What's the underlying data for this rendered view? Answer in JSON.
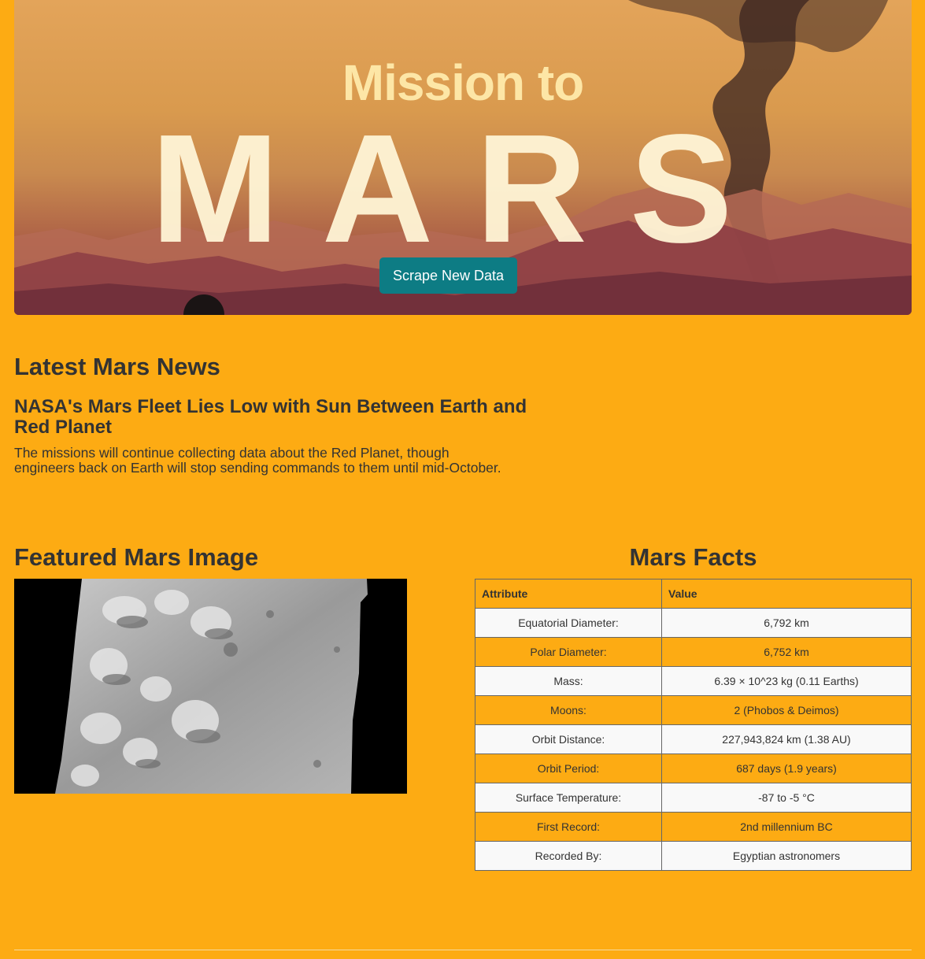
{
  "hero": {
    "subtitle": "Mission to",
    "title": "MARS",
    "scrape_button_label": "Scrape New Data"
  },
  "news": {
    "heading": "Latest Mars News",
    "title": "NASA's Mars Fleet Lies Low with Sun Between Earth and Red Planet",
    "paragraph": "The missions will continue collecting data about the Red Planet, though engineers back on Earth will stop sending commands to them until mid-October."
  },
  "featured": {
    "heading": "Featured Mars Image"
  },
  "facts": {
    "heading": "Mars Facts",
    "columns": [
      "Attribute",
      "Value"
    ],
    "rows": [
      [
        "Equatorial Diameter:",
        "6,792 km"
      ],
      [
        "Polar Diameter:",
        "6,752 km"
      ],
      [
        "Mass:",
        "6.39 × 10^23 kg (0.11 Earths)"
      ],
      [
        "Moons:",
        "2 (Phobos & Deimos)"
      ],
      [
        "Orbit Distance:",
        "227,943,824 km (1.38 AU)"
      ],
      [
        "Orbit Period:",
        "687 days (1.9 years)"
      ],
      [
        "Surface Temperature:",
        "-87 to -5 °C"
      ],
      [
        "First Record:",
        "2nd millennium BC"
      ],
      [
        "Recorded By:",
        "Egyptian astronomers"
      ]
    ]
  },
  "colors": {
    "page_background": "#fdab13",
    "button": "#0d7c84",
    "text": "#333333"
  }
}
